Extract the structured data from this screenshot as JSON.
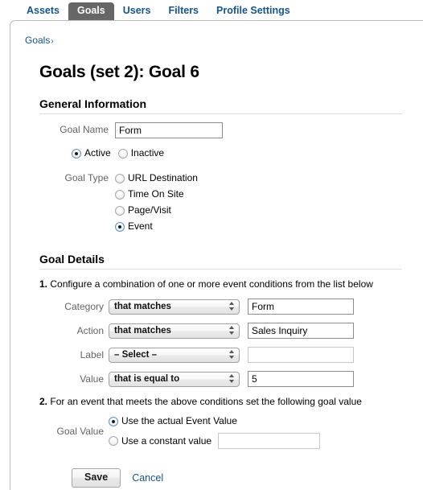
{
  "tabs": [
    {
      "label": "Assets",
      "selected": false
    },
    {
      "label": "Goals",
      "selected": true
    },
    {
      "label": "Users",
      "selected": false
    },
    {
      "label": "Filters",
      "selected": false
    },
    {
      "label": "Profile Settings",
      "selected": false
    }
  ],
  "breadcrumb": {
    "root": "Goals",
    "separator": "›"
  },
  "page_title": "Goals (set 2): Goal 6",
  "general": {
    "heading": "General Information",
    "goal_name_label": "Goal Name",
    "goal_name_value": "Form",
    "status": {
      "active_label": "Active",
      "inactive_label": "Inactive",
      "selected": "Active"
    },
    "goal_type_label": "Goal Type",
    "goal_type_options": [
      "URL Destination",
      "Time On Site",
      "Page/Visit",
      "Event"
    ],
    "goal_type_selected": "Event"
  },
  "details": {
    "heading": "Goal Details",
    "step1_number": "1.",
    "step1_text": "Configure a combination of one or more event conditions from the list below",
    "conditions": [
      {
        "label": "Category",
        "match_value": "that matches",
        "text_value": "Form",
        "text_disabled": false
      },
      {
        "label": "Action",
        "match_value": "that matches",
        "text_value": "Sales Inquiry",
        "text_disabled": false
      },
      {
        "label": "Label",
        "match_value": "– Select –",
        "text_value": "",
        "text_disabled": true
      },
      {
        "label": "Value",
        "match_value": "that is equal to",
        "text_value": "5",
        "text_disabled": false
      }
    ],
    "step2_number": "2.",
    "step2_text": "For an event that meets the above conditions set the following goal value",
    "goal_value_label": "Goal Value",
    "goal_value_options": [
      "Use the actual Event Value",
      "Use a constant value"
    ],
    "goal_value_selected": "Use the actual Event Value",
    "constant_value": ""
  },
  "footer": {
    "save_label": "Save",
    "cancel_label": "Cancel"
  },
  "colors": {
    "link": "#15548c",
    "selected_tab_bg": "#666666",
    "label_gray": "#636363"
  }
}
